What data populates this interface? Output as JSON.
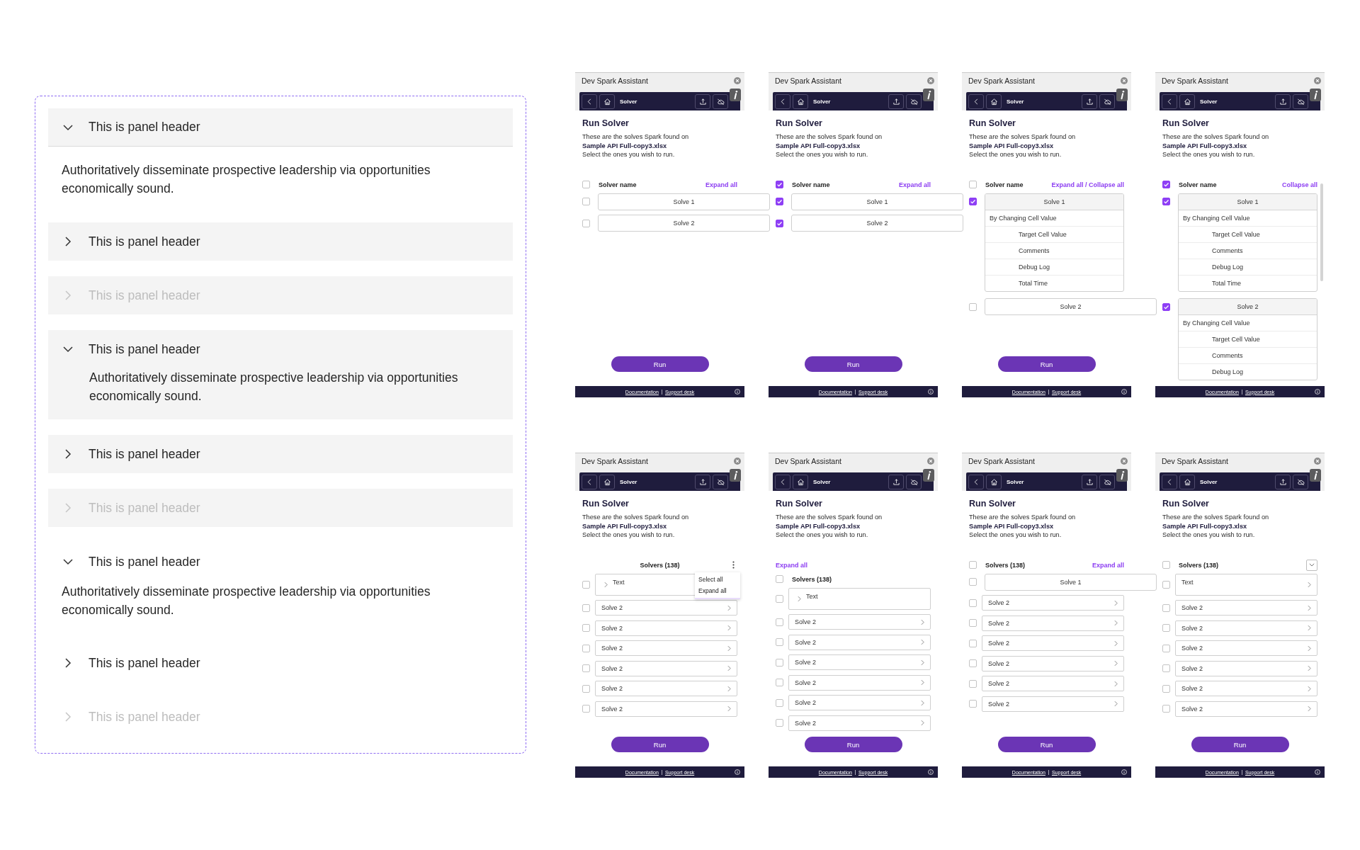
{
  "accordion_groups": [
    {
      "kind": "bordered",
      "panels": [
        {
          "header": "This is panel header",
          "expanded": true,
          "disabled": false,
          "content": "Authoritatively disseminate prospective leadership via opportunities economically sound."
        },
        {
          "header": "This is panel header",
          "expanded": false,
          "disabled": false
        },
        {
          "header": "This is panel header",
          "expanded": false,
          "disabled": true
        }
      ]
    },
    {
      "kind": "filled",
      "panels": [
        {
          "header": "This is panel header",
          "expanded": true,
          "disabled": false,
          "content": "Authoritatively disseminate prospective leadership via opportunities economically sound."
        },
        {
          "header": "This is panel header",
          "expanded": false,
          "disabled": false
        },
        {
          "header": "This is panel header",
          "expanded": false,
          "disabled": true
        }
      ]
    },
    {
      "kind": "ghost",
      "panels": [
        {
          "header": "This is panel header",
          "expanded": true,
          "disabled": false,
          "content": "Authoritatively disseminate prospective leadership via opportunities economically sound."
        },
        {
          "header": "This is panel header",
          "expanded": false,
          "disabled": false
        },
        {
          "header": "This is panel header",
          "expanded": false,
          "disabled": true
        }
      ]
    }
  ],
  "screens": [
    {
      "window_title": "Dev Spark Assistant",
      "toolbar_title": "Solver",
      "heading": "Run Solver",
      "description": "These are the solves Spark found on",
      "file_name": "Sample API Full-copy3.xlsx",
      "instruction": "Select the ones you wish to run.",
      "list_header": {
        "kind": "link",
        "checked": false,
        "label": "Solver name",
        "action": "Expand all"
      },
      "rows": [
        {
          "kind": "solver",
          "label": "Solve 1",
          "checked": false,
          "expanded": false
        },
        {
          "kind": "solver",
          "label": "Solve 2",
          "checked": false,
          "expanded": false
        }
      ],
      "run_button": "Run",
      "footer_links": [
        "Documentation",
        "Support desk"
      ]
    },
    {
      "window_title": "Dev Spark Assistant",
      "toolbar_title": "Solver",
      "heading": "Run Solver",
      "description": "These are the solves Spark found on",
      "file_name": "Sample API Full-copy3.xlsx",
      "instruction": "Select the ones you wish to run.",
      "list_header": {
        "kind": "link",
        "checked": true,
        "label": "Solver name",
        "action": "Expand all"
      },
      "rows": [
        {
          "kind": "solver",
          "label": "Solve 1",
          "checked": true,
          "expanded": false
        },
        {
          "kind": "solver",
          "label": "Solve 2",
          "checked": true,
          "expanded": false
        }
      ],
      "run_button": "Run",
      "footer_links": [
        "Documentation",
        "Support desk"
      ]
    },
    {
      "window_title": "Dev Spark Assistant",
      "toolbar_title": "Solver",
      "heading": "Run Solver",
      "description": "These are the solves Spark found on",
      "file_name": "Sample API Full-copy3.xlsx",
      "instruction": "Select the ones you wish to run.",
      "list_header": {
        "kind": "link",
        "checked": false,
        "label": "Solver name",
        "action": "Expand all / Collapse all"
      },
      "rows": [
        {
          "kind": "solver",
          "label": "Solve 1",
          "checked": true,
          "expanded": true,
          "details": [
            {
              "label": "By Changing Cell Value",
              "children": [
                {
                  "label": "Target Cell Value"
                },
                {
                  "label": "Comments"
                },
                {
                  "label": "Debug Log"
                },
                {
                  "label": "Total Time"
                }
              ]
            }
          ]
        },
        {
          "kind": "solver",
          "label": "Solve 2",
          "checked": false,
          "expanded": false
        }
      ],
      "run_button": "Run",
      "footer_links": [
        "Documentation",
        "Support desk"
      ]
    },
    {
      "window_title": "Dev Spark Assistant",
      "toolbar_title": "Solver",
      "heading": "Run Solver",
      "description": "These are the solves Spark found on",
      "file_name": "Sample API Full-copy3.xlsx",
      "instruction": "Select the ones you wish to run.",
      "list_header": {
        "kind": "link",
        "checked": true,
        "label": "Solver name",
        "action": "Collapse all"
      },
      "rows": [
        {
          "kind": "solver",
          "label": "Solve 1",
          "checked": true,
          "expanded": true,
          "details": [
            {
              "label": "By Changing Cell Value",
              "children": [
                {
                  "label": "Target Cell Value"
                },
                {
                  "label": "Comments"
                },
                {
                  "label": "Debug Log"
                },
                {
                  "label": "Total Time"
                }
              ]
            }
          ]
        },
        {
          "kind": "solver",
          "label": "Solve 2",
          "checked": true,
          "expanded": true,
          "details": [
            {
              "label": "By Changing Cell Value",
              "children": [
                {
                  "label": "Target Cell Value"
                },
                {
                  "label": "Comments"
                },
                {
                  "label": "Debug Log"
                }
              ]
            }
          ]
        }
      ],
      "scrollbar": true,
      "footer_links": [
        "Documentation",
        "Support desk"
      ]
    },
    {
      "window_title": "Dev Spark Assistant",
      "toolbar_title": "Solver",
      "heading": "Run Solver",
      "description": "These are the solves Spark found on",
      "file_name": "Sample API Full-copy3.xlsx",
      "instruction": "Select the ones you wish to run.",
      "list_header": {
        "kind": "menu",
        "label": "Solvers (138)",
        "menu_open": true,
        "menu_items": [
          "Select all",
          "Expand all"
        ]
      },
      "rows": [
        {
          "kind": "group",
          "label": "Text",
          "checked": false
        },
        {
          "kind": "item",
          "label": "Solve 2",
          "checked": false
        },
        {
          "kind": "item",
          "label": "Solve 2",
          "checked": false
        },
        {
          "kind": "item",
          "label": "Solve 2",
          "checked": false
        },
        {
          "kind": "item",
          "label": "Solve 2",
          "checked": false
        },
        {
          "kind": "item",
          "label": "Solve 2",
          "checked": false
        },
        {
          "kind": "item",
          "label": "Solve 2",
          "checked": false
        }
      ],
      "run_button": "Run",
      "footer_links": [
        "Documentation",
        "Support desk"
      ]
    },
    {
      "window_title": "Dev Spark Assistant",
      "toolbar_title": "Solver",
      "heading": "Run Solver",
      "description": "These are the solves Spark found on",
      "file_name": "Sample API Full-copy3.xlsx",
      "instruction": "Select the ones you wish to run.",
      "list_header": {
        "kind": "link_above",
        "action": "Expand all",
        "checked": false,
        "label": "Solvers (138)"
      },
      "rows": [
        {
          "kind": "group",
          "label": "Text",
          "checked": false
        },
        {
          "kind": "item",
          "label": "Solve 2",
          "checked": false
        },
        {
          "kind": "item",
          "label": "Solve 2",
          "checked": false
        },
        {
          "kind": "item",
          "label": "Solve 2",
          "checked": false
        },
        {
          "kind": "item",
          "label": "Solve 2",
          "checked": false
        },
        {
          "kind": "item",
          "label": "Solve 2",
          "checked": false
        },
        {
          "kind": "item",
          "label": "Solve 2",
          "checked": false
        }
      ],
      "run_button": "Run",
      "footer_links": [
        "Documentation",
        "Support desk"
      ]
    },
    {
      "window_title": "Dev Spark Assistant",
      "toolbar_title": "Solver",
      "heading": "Run Solver",
      "description": "These are the solves Spark found on",
      "file_name": "Sample API Full-copy3.xlsx",
      "instruction": "Select the ones you wish to run.",
      "list_header": {
        "kind": "link",
        "checked": false,
        "label": "Solvers (138)",
        "action": "Expand all"
      },
      "rows": [
        {
          "kind": "solver",
          "label": "Solve 1",
          "checked": false,
          "expanded": false
        },
        {
          "kind": "item",
          "label": "Solve 2",
          "checked": false
        },
        {
          "kind": "item",
          "label": "Solve 2",
          "checked": false
        },
        {
          "kind": "item",
          "label": "Solve 2",
          "checked": false
        },
        {
          "kind": "item",
          "label": "Solve 2",
          "checked": false
        },
        {
          "kind": "item",
          "label": "Solve 2",
          "checked": false
        },
        {
          "kind": "item",
          "label": "Solve 2",
          "checked": false
        }
      ],
      "run_button": "Run",
      "footer_links": [
        "Documentation",
        "Support desk"
      ]
    },
    {
      "window_title": "Dev Spark Assistant",
      "toolbar_title": "Solver",
      "heading": "Run Solver",
      "description": "These are the solves Spark found on",
      "file_name": "Sample API Full-copy3.xlsx",
      "instruction": "Select the ones you wish to run.",
      "list_header": {
        "kind": "dropdown",
        "checked": false,
        "label": "Solvers (138)"
      },
      "rows": [
        {
          "kind": "block",
          "label": "Text",
          "checked": false
        },
        {
          "kind": "item",
          "label": "Solve 2",
          "checked": false
        },
        {
          "kind": "item",
          "label": "Solve 2",
          "checked": false
        },
        {
          "kind": "item",
          "label": "Solve 2",
          "checked": false
        },
        {
          "kind": "item",
          "label": "Solve 2",
          "checked": false
        },
        {
          "kind": "item",
          "label": "Solve 2",
          "checked": false
        },
        {
          "kind": "item",
          "label": "Solve 2",
          "checked": false
        }
      ],
      "run_button": "Run",
      "footer_links": [
        "Documentation",
        "Support desk"
      ]
    }
  ]
}
